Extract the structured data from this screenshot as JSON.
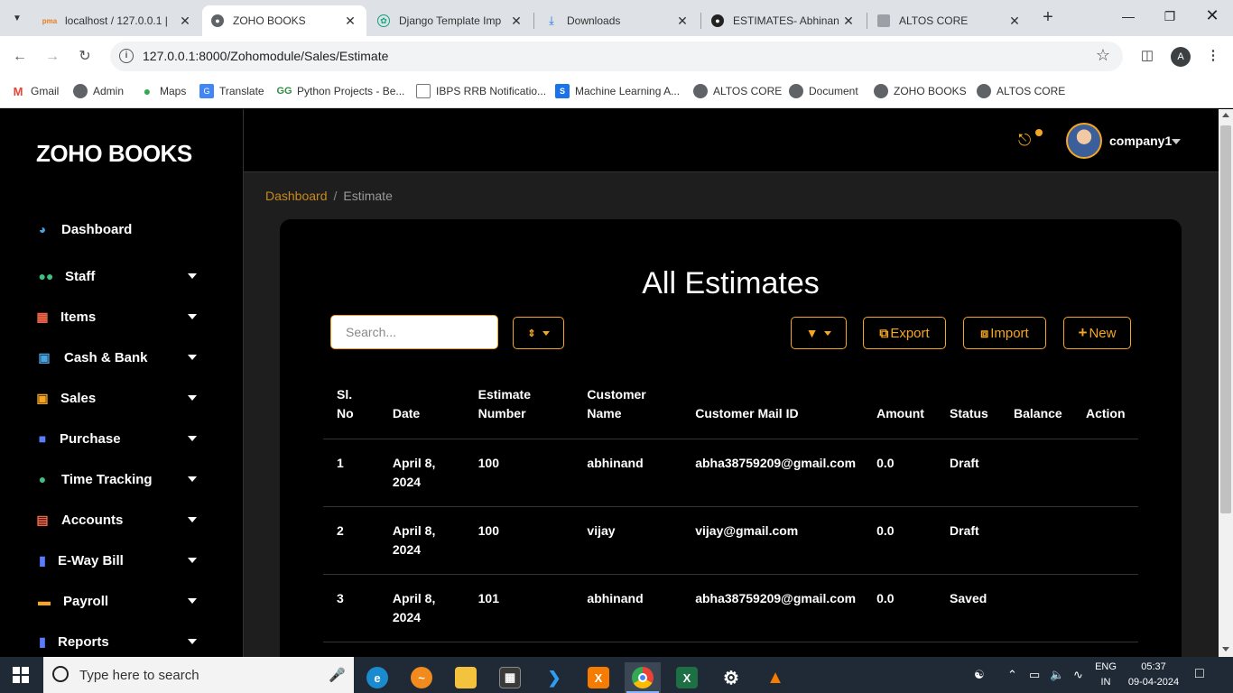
{
  "browser": {
    "tabs": [
      {
        "title": "localhost / 127.0.0.1 |",
        "favicon": "phpmyadmin-icon"
      },
      {
        "title": "ZOHO BOOKS",
        "favicon": "globe-icon",
        "active": true
      },
      {
        "title": "Django Template Imp",
        "favicon": "chatgpt-icon"
      },
      {
        "title": "Downloads",
        "favicon": "download-icon"
      },
      {
        "title": "ESTIMATES- Abhinan",
        "favicon": "github-icon"
      },
      {
        "title": "ALTOS CORE",
        "favicon": "page-icon"
      }
    ],
    "url": "127.0.0.1:8000/Zohomodule/Sales/Estimate",
    "profile_initial": "A",
    "bookmarks": [
      {
        "label": "Gmail",
        "icon": "gmail-icon"
      },
      {
        "label": "Admin",
        "icon": "globe-icon"
      },
      {
        "label": "Maps",
        "icon": "maps-icon"
      },
      {
        "label": "Translate",
        "icon": "translate-icon"
      },
      {
        "label": "Python Projects - Be...",
        "icon": "geeks-icon"
      },
      {
        "label": "IBPS RRB Notificatio...",
        "icon": "doc-icon"
      },
      {
        "label": "Machine Learning A...",
        "icon": "s-icon"
      },
      {
        "label": "ALTOS CORE",
        "icon": "globe-icon"
      },
      {
        "label": "Document",
        "icon": "globe-icon"
      },
      {
        "label": "ZOHO BOOKS",
        "icon": "globe-icon"
      },
      {
        "label": "ALTOS CORE",
        "icon": "globe-icon"
      }
    ]
  },
  "app": {
    "logo": "ZOHO BOOKS",
    "user": "company1",
    "accent_color": "#f5a623",
    "sidebar": [
      {
        "label": "Dashboard",
        "icon": "dashboard-icon",
        "has_dropdown": false
      },
      {
        "label": "Staff",
        "icon": "users-icon",
        "has_dropdown": true
      },
      {
        "label": "Items",
        "icon": "grid-icon",
        "has_dropdown": true
      },
      {
        "label": "Cash & Bank",
        "icon": "money-icon",
        "has_dropdown": true
      },
      {
        "label": "Sales",
        "icon": "cart-icon",
        "has_dropdown": true
      },
      {
        "label": "Purchase",
        "icon": "bag-icon",
        "has_dropdown": true
      },
      {
        "label": "Time Tracking",
        "icon": "clock-icon",
        "has_dropdown": true
      },
      {
        "label": "Accounts",
        "icon": "chart-icon",
        "has_dropdown": true
      },
      {
        "label": "E-Way Bill",
        "icon": "file-icon",
        "has_dropdown": true
      },
      {
        "label": "Payroll",
        "icon": "card-icon",
        "has_dropdown": true
      },
      {
        "label": "Reports",
        "icon": "report-icon",
        "has_dropdown": true
      }
    ],
    "breadcrumb": {
      "link": "Dashboard",
      "separator": "/",
      "current": "Estimate"
    },
    "page_title": "All Estimates",
    "search_placeholder": "Search...",
    "buttons": {
      "export": "Export",
      "import": "Import",
      "new": "New"
    },
    "table": {
      "headers": [
        "Sl. No",
        "Date",
        "Estimate Number",
        "Customer Name",
        "Customer Mail ID",
        "Amount",
        "Status",
        "Balance",
        "Action"
      ],
      "rows": [
        [
          "1",
          "April 8, 2024",
          "100",
          "abhinand",
          "abha38759209@gmail.com",
          "0.0",
          "Draft",
          "",
          ""
        ],
        [
          "2",
          "April 8, 2024",
          "100",
          "vijay",
          "vijay@gmail.com",
          "0.0",
          "Draft",
          "",
          ""
        ],
        [
          "3",
          "April 8, 2024",
          "101",
          "abhinand",
          "abha38759209@gmail.com",
          "0.0",
          "Saved",
          "",
          ""
        ]
      ]
    }
  },
  "taskbar": {
    "search_placeholder": "Type here to search",
    "lang_top": "ENG",
    "lang_bottom": "IN",
    "time": "05:37",
    "date": "09-04-2024"
  }
}
